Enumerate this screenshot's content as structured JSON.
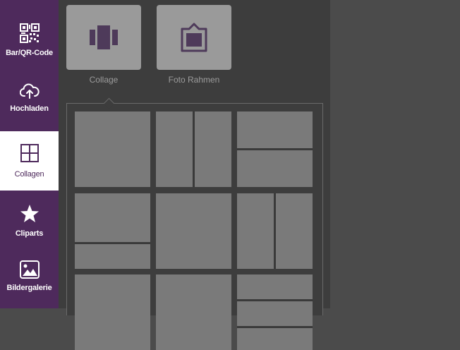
{
  "sidebar": {
    "items": [
      {
        "label": "Bar/QR-Code",
        "icon": "qr-code-icon"
      },
      {
        "label": "Hochladen",
        "icon": "cloud-upload-icon"
      },
      {
        "label": "Collagen",
        "icon": "collage-grid-icon"
      },
      {
        "label": "Cliparts",
        "icon": "star-icon"
      },
      {
        "label": "Bildergalerie",
        "icon": "image-gallery-icon"
      }
    ],
    "active_index": 2
  },
  "types": [
    {
      "label": "Collage",
      "icon": "collage-strip-icon"
    },
    {
      "label": "Foto Rahmen",
      "icon": "photo-frame-icon"
    }
  ],
  "colors": {
    "sidebar_bg": "#4e2a5c",
    "panel_bg": "#3d3d3d",
    "tile_bg": "#9a9a9a",
    "cell_bg": "#7a7a7a",
    "canvas_bg": "#4b4b4b"
  }
}
